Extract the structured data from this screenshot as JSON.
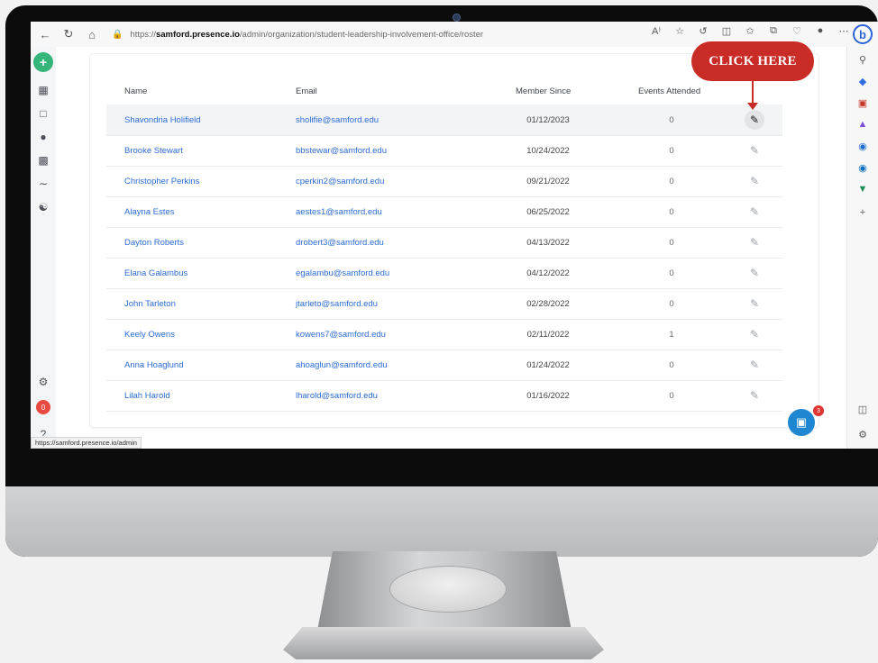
{
  "browser": {
    "url_prefix": "https://",
    "url_host": "samford.presence.io",
    "url_path": "/admin/organization/student-leadership-involvement-office/roster",
    "read_aloud": "A⁾",
    "status_url": "https://samford.presence.io/admin",
    "bing": "b"
  },
  "rail": {
    "add": "+",
    "notifications": "0"
  },
  "rsidebar": {
    "add": "+"
  },
  "table": {
    "headers": [
      "Name",
      "Email",
      "Member Since",
      "Events Attended"
    ],
    "rows": [
      {
        "name": "Shavondria Holifield",
        "email": "sholifie@samford.edu",
        "since": "01/12/2023",
        "events": "0"
      },
      {
        "name": "Brooke Stewart",
        "email": "bbstewar@samford.edu",
        "since": "10/24/2022",
        "events": "0"
      },
      {
        "name": "Christopher Perkins",
        "email": "cperkin2@samford.edu",
        "since": "09/21/2022",
        "events": "0"
      },
      {
        "name": "Alayna Estes",
        "email": "aestes1@samford.edu",
        "since": "06/25/2022",
        "events": "0"
      },
      {
        "name": "Dayton Roberts",
        "email": "drobert3@samford.edu",
        "since": "04/13/2022",
        "events": "0"
      },
      {
        "name": "Elana Galambus",
        "email": "egalambu@samford.edu",
        "since": "04/12/2022",
        "events": "0"
      },
      {
        "name": "John Tarleton",
        "email": "jtarleto@samford.edu",
        "since": "02/28/2022",
        "events": "0"
      },
      {
        "name": "Keely Owens",
        "email": "kowens7@samford.edu",
        "since": "02/11/2022",
        "events": "1"
      },
      {
        "name": "Anna Hoaglund",
        "email": "ahoaglun@samford.edu",
        "since": "01/24/2022",
        "events": "0"
      },
      {
        "name": "Lilah Harold",
        "email": "lharold@samford.edu",
        "since": "01/16/2022",
        "events": "0"
      }
    ]
  },
  "chat": {
    "badge": "3"
  },
  "callout": {
    "label": "CLICK HERE"
  },
  "colors": {
    "accent": "#2c6cd3",
    "callout": "#c92b27",
    "add": "#35b57a"
  }
}
